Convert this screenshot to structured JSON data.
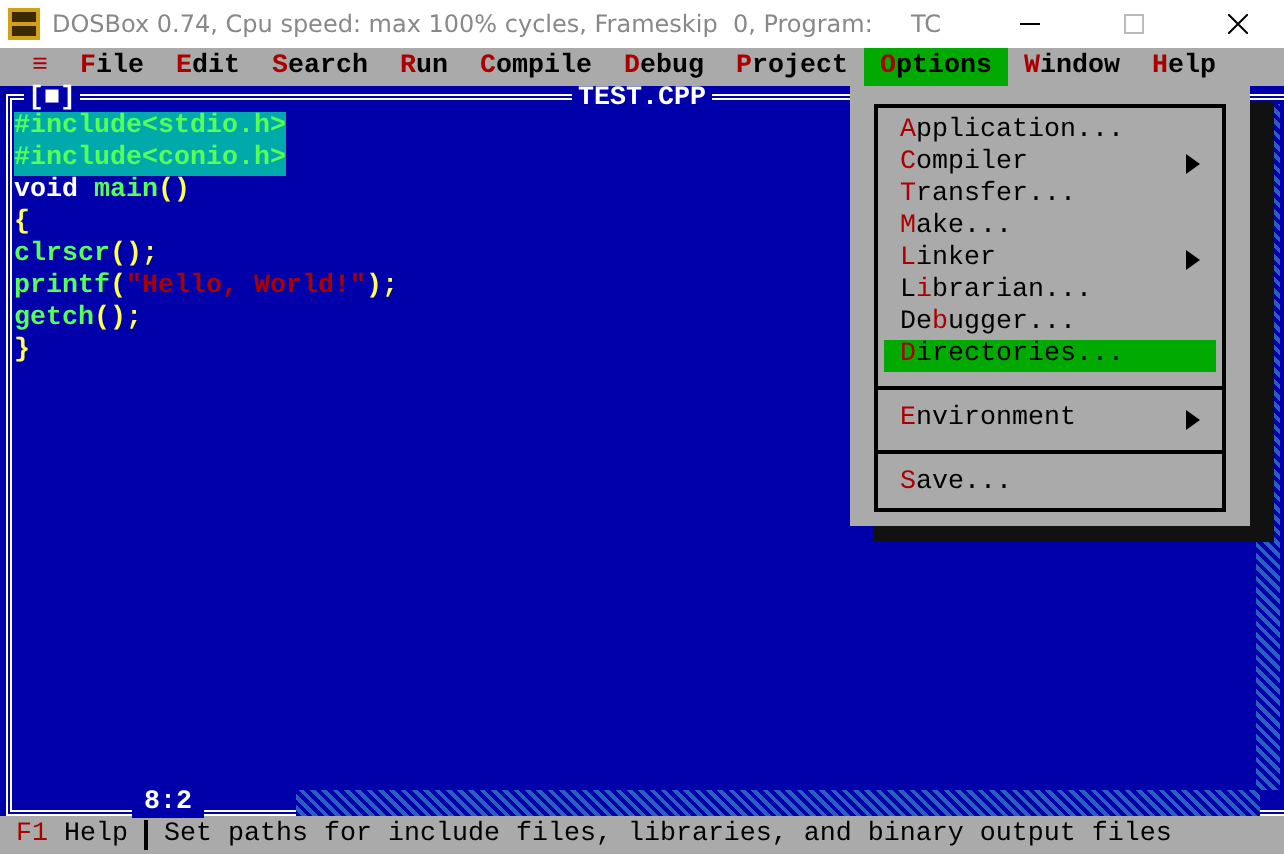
{
  "window": {
    "title": "DOSBox 0.74, Cpu speed: max 100% cycles, Frameskip  0, Program:     TC"
  },
  "menu_bar": [
    {
      "key": "≡",
      "selected": false
    },
    {
      "key": "F",
      "after": "ile",
      "selected": false
    },
    {
      "key": "E",
      "after": "dit",
      "selected": false
    },
    {
      "key": "S",
      "after": "earch",
      "selected": false
    },
    {
      "key": "R",
      "after": "un",
      "selected": false
    },
    {
      "key": "C",
      "after": "ompile",
      "selected": false
    },
    {
      "key": "D",
      "after": "ebug",
      "selected": false
    },
    {
      "key": "P",
      "after": "roject",
      "selected": false
    },
    {
      "key": "O",
      "after": "ptions",
      "selected": true
    },
    {
      "key": "W",
      "after": "indow",
      "selected": false
    },
    {
      "key": "H",
      "after": "elp",
      "selected": false
    }
  ],
  "editor": {
    "title": "TEST.CPP",
    "close_box": "[■]",
    "position": "8:2",
    "lines": [
      {
        "selected": true,
        "tokens": [
          {
            "kind": "ident",
            "text": "#include<stdio.h>"
          }
        ]
      },
      {
        "selected": true,
        "tokens": [
          {
            "kind": "ident",
            "text": "#include<conio.h>"
          }
        ]
      },
      {
        "selected": false,
        "tokens": [
          {
            "kind": "keyword",
            "text": "void "
          },
          {
            "kind": "ident",
            "text": "main"
          },
          {
            "kind": "punct",
            "text": "()"
          }
        ]
      },
      {
        "selected": false,
        "tokens": [
          {
            "kind": "punct",
            "text": "{"
          }
        ]
      },
      {
        "selected": false,
        "tokens": [
          {
            "kind": "ident",
            "text": "clrscr"
          },
          {
            "kind": "punct",
            "text": "();"
          }
        ]
      },
      {
        "selected": false,
        "tokens": [
          {
            "kind": "ident",
            "text": "printf"
          },
          {
            "kind": "punct",
            "text": "("
          },
          {
            "kind": "string",
            "text": "\"Hello, World!\""
          },
          {
            "kind": "punct",
            "text": ");"
          }
        ]
      },
      {
        "selected": false,
        "tokens": [
          {
            "kind": "ident",
            "text": "getch"
          },
          {
            "kind": "punct",
            "text": "();"
          }
        ]
      },
      {
        "selected": false,
        "tokens": [
          {
            "kind": "punct",
            "text": "}"
          }
        ]
      }
    ]
  },
  "options_menu": {
    "groups": [
      [
        {
          "key": "A",
          "after": "pplication...",
          "submenu": false,
          "selected": false
        },
        {
          "key": "C",
          "after": "ompiler",
          "submenu": true,
          "selected": false
        },
        {
          "key": "T",
          "after": "ransfer...",
          "submenu": false,
          "selected": false
        },
        {
          "key": "M",
          "after": "ake...",
          "submenu": false,
          "selected": false
        },
        {
          "key": "L",
          "after": "inker",
          "submenu": true,
          "selected": false
        },
        {
          "before": "L",
          "key": "i",
          "after": "brarian...",
          "submenu": false,
          "selected": false
        },
        {
          "before": "De",
          "key": "b",
          "after": "ugger...",
          "submenu": false,
          "selected": false
        },
        {
          "key": "D",
          "after": "irectories...",
          "submenu": false,
          "selected": true
        }
      ],
      [
        {
          "key": "E",
          "after": "nvironment",
          "submenu": true,
          "selected": false
        }
      ],
      [
        {
          "key": "S",
          "after": "ave...",
          "submenu": false,
          "selected": false
        }
      ]
    ]
  },
  "status_bar": {
    "key": "F1",
    "label": "Help",
    "message": "Set paths for include files, libraries, and binary output files"
  }
}
